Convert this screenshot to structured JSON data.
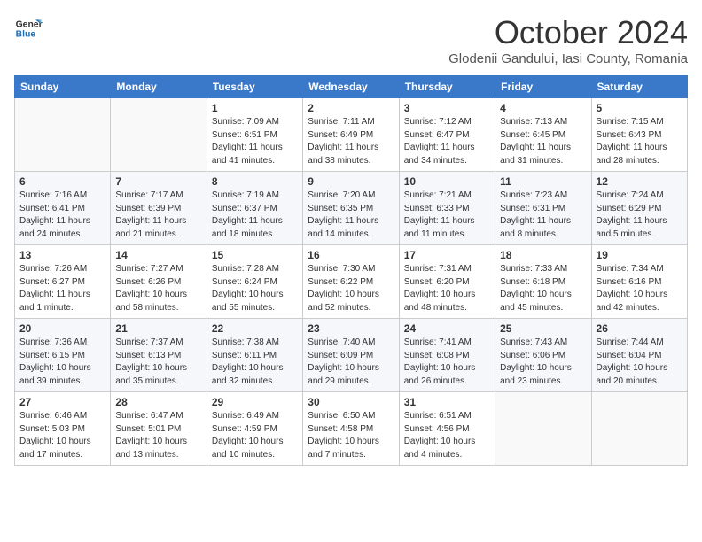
{
  "header": {
    "logo_general": "General",
    "logo_blue": "Blue",
    "month": "October 2024",
    "location": "Glodenii Gandului, Iasi County, Romania"
  },
  "weekdays": [
    "Sunday",
    "Monday",
    "Tuesday",
    "Wednesday",
    "Thursday",
    "Friday",
    "Saturday"
  ],
  "weeks": [
    [
      {
        "day": "",
        "info": ""
      },
      {
        "day": "",
        "info": ""
      },
      {
        "day": "1",
        "info": "Sunrise: 7:09 AM\nSunset: 6:51 PM\nDaylight: 11 hours and 41 minutes."
      },
      {
        "day": "2",
        "info": "Sunrise: 7:11 AM\nSunset: 6:49 PM\nDaylight: 11 hours and 38 minutes."
      },
      {
        "day": "3",
        "info": "Sunrise: 7:12 AM\nSunset: 6:47 PM\nDaylight: 11 hours and 34 minutes."
      },
      {
        "day": "4",
        "info": "Sunrise: 7:13 AM\nSunset: 6:45 PM\nDaylight: 11 hours and 31 minutes."
      },
      {
        "day": "5",
        "info": "Sunrise: 7:15 AM\nSunset: 6:43 PM\nDaylight: 11 hours and 28 minutes."
      }
    ],
    [
      {
        "day": "6",
        "info": "Sunrise: 7:16 AM\nSunset: 6:41 PM\nDaylight: 11 hours and 24 minutes."
      },
      {
        "day": "7",
        "info": "Sunrise: 7:17 AM\nSunset: 6:39 PM\nDaylight: 11 hours and 21 minutes."
      },
      {
        "day": "8",
        "info": "Sunrise: 7:19 AM\nSunset: 6:37 PM\nDaylight: 11 hours and 18 minutes."
      },
      {
        "day": "9",
        "info": "Sunrise: 7:20 AM\nSunset: 6:35 PM\nDaylight: 11 hours and 14 minutes."
      },
      {
        "day": "10",
        "info": "Sunrise: 7:21 AM\nSunset: 6:33 PM\nDaylight: 11 hours and 11 minutes."
      },
      {
        "day": "11",
        "info": "Sunrise: 7:23 AM\nSunset: 6:31 PM\nDaylight: 11 hours and 8 minutes."
      },
      {
        "day": "12",
        "info": "Sunrise: 7:24 AM\nSunset: 6:29 PM\nDaylight: 11 hours and 5 minutes."
      }
    ],
    [
      {
        "day": "13",
        "info": "Sunrise: 7:26 AM\nSunset: 6:27 PM\nDaylight: 11 hours and 1 minute."
      },
      {
        "day": "14",
        "info": "Sunrise: 7:27 AM\nSunset: 6:26 PM\nDaylight: 10 hours and 58 minutes."
      },
      {
        "day": "15",
        "info": "Sunrise: 7:28 AM\nSunset: 6:24 PM\nDaylight: 10 hours and 55 minutes."
      },
      {
        "day": "16",
        "info": "Sunrise: 7:30 AM\nSunset: 6:22 PM\nDaylight: 10 hours and 52 minutes."
      },
      {
        "day": "17",
        "info": "Sunrise: 7:31 AM\nSunset: 6:20 PM\nDaylight: 10 hours and 48 minutes."
      },
      {
        "day": "18",
        "info": "Sunrise: 7:33 AM\nSunset: 6:18 PM\nDaylight: 10 hours and 45 minutes."
      },
      {
        "day": "19",
        "info": "Sunrise: 7:34 AM\nSunset: 6:16 PM\nDaylight: 10 hours and 42 minutes."
      }
    ],
    [
      {
        "day": "20",
        "info": "Sunrise: 7:36 AM\nSunset: 6:15 PM\nDaylight: 10 hours and 39 minutes."
      },
      {
        "day": "21",
        "info": "Sunrise: 7:37 AM\nSunset: 6:13 PM\nDaylight: 10 hours and 35 minutes."
      },
      {
        "day": "22",
        "info": "Sunrise: 7:38 AM\nSunset: 6:11 PM\nDaylight: 10 hours and 32 minutes."
      },
      {
        "day": "23",
        "info": "Sunrise: 7:40 AM\nSunset: 6:09 PM\nDaylight: 10 hours and 29 minutes."
      },
      {
        "day": "24",
        "info": "Sunrise: 7:41 AM\nSunset: 6:08 PM\nDaylight: 10 hours and 26 minutes."
      },
      {
        "day": "25",
        "info": "Sunrise: 7:43 AM\nSunset: 6:06 PM\nDaylight: 10 hours and 23 minutes."
      },
      {
        "day": "26",
        "info": "Sunrise: 7:44 AM\nSunset: 6:04 PM\nDaylight: 10 hours and 20 minutes."
      }
    ],
    [
      {
        "day": "27",
        "info": "Sunrise: 6:46 AM\nSunset: 5:03 PM\nDaylight: 10 hours and 17 minutes."
      },
      {
        "day": "28",
        "info": "Sunrise: 6:47 AM\nSunset: 5:01 PM\nDaylight: 10 hours and 13 minutes."
      },
      {
        "day": "29",
        "info": "Sunrise: 6:49 AM\nSunset: 4:59 PM\nDaylight: 10 hours and 10 minutes."
      },
      {
        "day": "30",
        "info": "Sunrise: 6:50 AM\nSunset: 4:58 PM\nDaylight: 10 hours and 7 minutes."
      },
      {
        "day": "31",
        "info": "Sunrise: 6:51 AM\nSunset: 4:56 PM\nDaylight: 10 hours and 4 minutes."
      },
      {
        "day": "",
        "info": ""
      },
      {
        "day": "",
        "info": ""
      }
    ]
  ]
}
